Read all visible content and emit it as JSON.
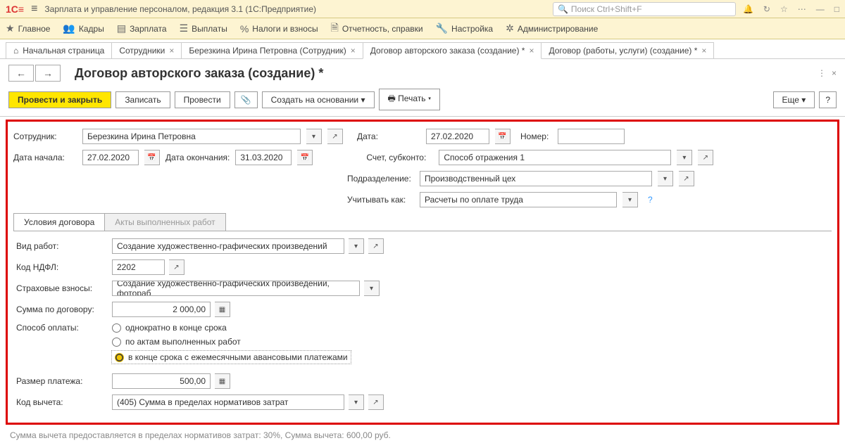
{
  "app": {
    "title": "Зарплата и управление персоналом, редакция 3.1  (1С:Предприятие)",
    "search_placeholder": "Поиск Ctrl+Shift+F"
  },
  "menu": [
    {
      "icon": "★",
      "label": "Главное"
    },
    {
      "icon": "👥",
      "label": "Кадры"
    },
    {
      "icon": "▤",
      "label": "Зарплата"
    },
    {
      "icon": "☰",
      "label": "Выплаты"
    },
    {
      "icon": "%",
      "label": "Налоги и взносы"
    },
    {
      "icon": "🗎",
      "label": "Отчетность, справки"
    },
    {
      "icon": "🔧",
      "label": "Настройка"
    },
    {
      "icon": "✲",
      "label": "Администрирование"
    }
  ],
  "tabs": [
    {
      "icon": "⌂",
      "label": "Начальная страница",
      "closable": false
    },
    {
      "label": "Сотрудники",
      "closable": true
    },
    {
      "label": "Березкина Ирина Петровна (Сотрудник)",
      "closable": true
    },
    {
      "label": "Договор авторского заказа (создание) *",
      "closable": true,
      "active": true
    },
    {
      "label": "Договор (работы, услуги) (создание) *",
      "closable": true
    }
  ],
  "page_title": "Договор авторского заказа (создание) *",
  "toolbar": {
    "post_close": "Провести и закрыть",
    "write": "Записать",
    "post": "Провести",
    "create_based": "Создать на основании",
    "print": "Печать",
    "more": "Еще"
  },
  "form": {
    "employee_lbl": "Сотрудник:",
    "employee": "Березкина Ирина Петровна",
    "date_lbl": "Дата:",
    "date": "27.02.2020",
    "number_lbl": "Номер:",
    "number": "",
    "start_lbl": "Дата начала:",
    "start": "27.02.2020",
    "end_lbl": "Дата окончания:",
    "end": "31.03.2020",
    "account_lbl": "Счет, субконто:",
    "account": "Способ отражения 1",
    "dept_lbl": "Подразделение:",
    "dept": "Производственный цех",
    "consider_lbl": "Учитывать как:",
    "consider": "Расчеты по оплате труда"
  },
  "tabs2": {
    "t1": "Условия договора",
    "t2": "Акты выполненных работ"
  },
  "contract": {
    "work_type_lbl": "Вид работ:",
    "work_type": "Создание художественно-графических произведений",
    "ndfl_lbl": "Код НДФЛ:",
    "ndfl": "2202",
    "ins_lbl": "Страховые взносы:",
    "ins": "Создание художественно-графических произведений, фотораб",
    "sum_lbl": "Сумма по договору:",
    "sum": "2 000,00",
    "pay_lbl": "Способ оплаты:",
    "pay_opt1": "однократно в конце срока",
    "pay_opt2": "по актам выполненных работ",
    "pay_opt3": "в конце срока с ежемесячными авансовыми платежами",
    "pay_size_lbl": "Размер платежа:",
    "pay_size": "500,00",
    "deduct_lbl": "Код вычета:",
    "deduct": "(405) Сумма в пределах нормативов затрат"
  },
  "footer": "Сумма вычета предоставляется в пределах нормативов затрат: 30%,  Сумма вычета: 600,00 руб."
}
